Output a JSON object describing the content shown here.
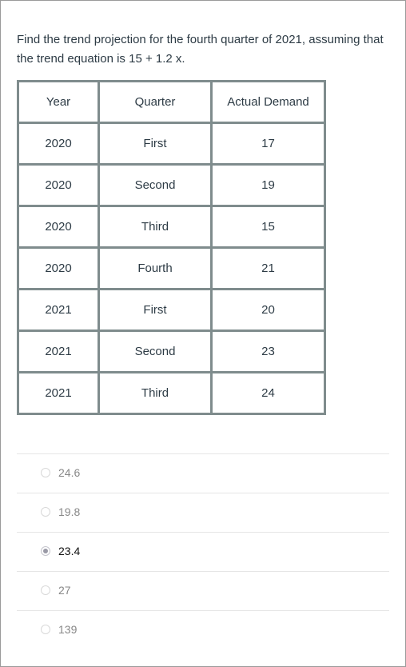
{
  "question": {
    "text": "Find the trend projection for the fourth quarter of 2021, assuming that the trend equation is 15 + 1.2 x."
  },
  "table": {
    "headers": [
      "Year",
      "Quarter",
      "Actual Demand"
    ],
    "rows": [
      [
        "2020",
        "First",
        "17"
      ],
      [
        "2020",
        "Second",
        "19"
      ],
      [
        "2020",
        "Third",
        "15"
      ],
      [
        "2020",
        "Fourth",
        "21"
      ],
      [
        "2021",
        "First",
        "20"
      ],
      [
        "2021",
        "Second",
        "23"
      ],
      [
        "2021",
        "Third",
        "24"
      ]
    ]
  },
  "answers": [
    {
      "label": "24.6",
      "selected": false
    },
    {
      "label": "19.8",
      "selected": false
    },
    {
      "label": "23.4",
      "selected": true
    },
    {
      "label": "27",
      "selected": false
    },
    {
      "label": "139",
      "selected": false
    }
  ]
}
